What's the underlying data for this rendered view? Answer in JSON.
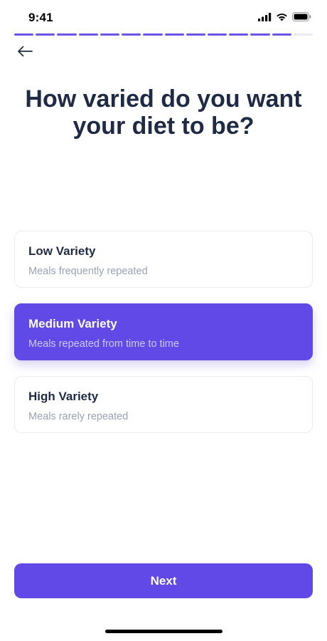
{
  "status_bar": {
    "time": "9:41",
    "icons": [
      "cellular-signal-icon",
      "wifi-icon",
      "battery-icon"
    ]
  },
  "progress": {
    "total_steps": 14,
    "completed_steps": 13,
    "accent_color": "#6a54e6"
  },
  "header": {
    "back_icon": "arrow-left-icon"
  },
  "question": {
    "title": "How varied do you want your diet to be?"
  },
  "options": [
    {
      "title": "Low Variety",
      "subtitle": "Meals frequently repeated",
      "selected": false
    },
    {
      "title": "Medium Variety",
      "subtitle": "Meals repeated from time to time",
      "selected": true
    },
    {
      "title": "High Variety",
      "subtitle": "Meals rarely repeated",
      "selected": false
    }
  ],
  "footer": {
    "next_label": "Next"
  },
  "colors": {
    "primary": "#6049e6",
    "title_text": "#1f2a44",
    "subtitle_text": "#98a2b8"
  }
}
